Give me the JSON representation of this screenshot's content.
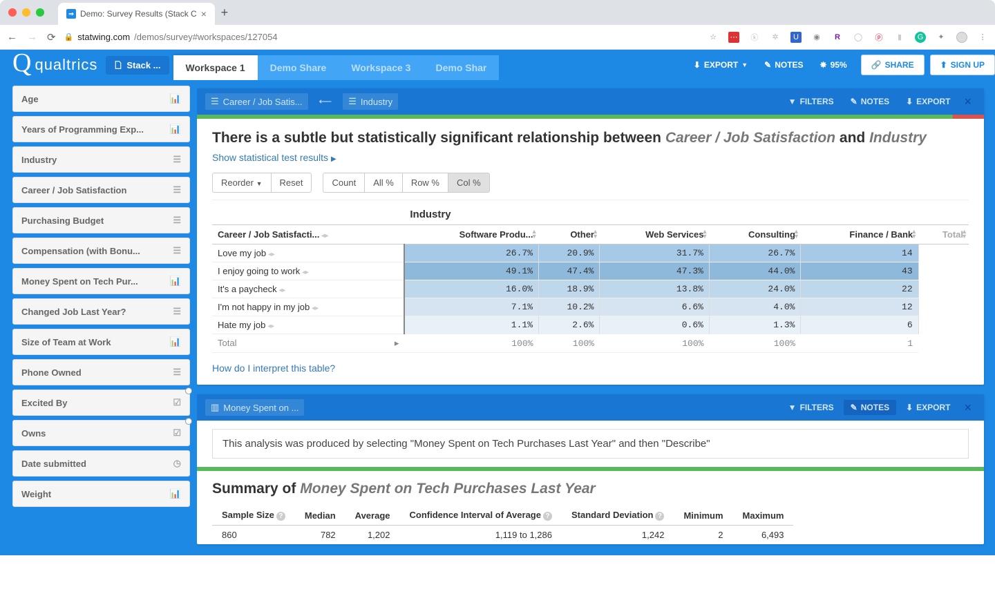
{
  "browser": {
    "tab_title": "Demo: Survey Results (Stack C",
    "url_domain": "statwing.com",
    "url_path": "/demos/survey#workspaces/127054"
  },
  "app": {
    "brand": "qualtrics",
    "file_label": "Stack ...",
    "workspace_tabs": [
      "Workspace 1",
      "Demo Share",
      "Workspace 3",
      "Demo Shar"
    ],
    "header_buttons": {
      "export": "EXPORT",
      "notes": "NOTES",
      "percent": "95%",
      "share": "SHARE",
      "signup": "SIGN UP"
    }
  },
  "sidebar": [
    {
      "label": "Age",
      "icon": "chart"
    },
    {
      "label": "Years of Programming Exp...",
      "icon": "chart"
    },
    {
      "label": "Industry",
      "icon": "list"
    },
    {
      "label": "Career / Job Satisfaction",
      "icon": "list"
    },
    {
      "label": "Purchasing Budget",
      "icon": "list"
    },
    {
      "label": "Compensation (with Bonu...",
      "icon": "list"
    },
    {
      "label": "Money Spent on Tech Pur...",
      "icon": "chart"
    },
    {
      "label": "Changed Job Last Year?",
      "icon": "list"
    },
    {
      "label": "Size of Team at Work",
      "icon": "chart"
    },
    {
      "label": "Phone Owned",
      "icon": "list"
    },
    {
      "label": "Excited By",
      "icon": "check",
      "dot": true
    },
    {
      "label": "Owns",
      "icon": "check",
      "dot": true
    },
    {
      "label": "Date submitted",
      "icon": "clock"
    },
    {
      "label": "Weight",
      "icon": "chart"
    }
  ],
  "card1": {
    "chips": [
      "Career / Job Satis...",
      "Industry"
    ],
    "actions": {
      "filters": "FILTERS",
      "notes": "NOTES",
      "export": "EXPORT"
    },
    "headline_pre": "There is a subtle but statistically significant relationship between ",
    "headline_var1": "Career / Job Satisfaction",
    "headline_mid": " and ",
    "headline_var2": "Industry",
    "show_test": "Show statistical test results",
    "btn_row": {
      "reorder": "Reorder",
      "reset": "Reset",
      "count": "Count",
      "allp": "All %",
      "rowp": "Row %",
      "colp": "Col %"
    },
    "super_col": "Industry",
    "row_header": "Career / Job Satisfacti...",
    "cols": [
      "Software Produ...",
      "Other",
      "Web Services",
      "Consulting",
      "Finance / Bank",
      "Total"
    ],
    "rows": [
      {
        "label": "Love my job",
        "vals": [
          "26.7%",
          "20.9%",
          "31.7%",
          "26.7%",
          "14"
        ]
      },
      {
        "label": "I enjoy going to work",
        "vals": [
          "49.1%",
          "47.4%",
          "47.3%",
          "44.0%",
          "43"
        ]
      },
      {
        "label": "It's a paycheck",
        "vals": [
          "16.0%",
          "18.9%",
          "13.8%",
          "24.0%",
          "22"
        ]
      },
      {
        "label": "I'm not happy in my job",
        "vals": [
          "7.1%",
          "10.2%",
          "6.6%",
          "4.0%",
          "12"
        ]
      },
      {
        "label": "Hate my job",
        "vals": [
          "1.1%",
          "2.6%",
          "0.6%",
          "1.3%",
          "6"
        ]
      }
    ],
    "total_row": {
      "label": "Total",
      "vals": [
        "100%",
        "100%",
        "100%",
        "100%",
        "1"
      ]
    },
    "interpret": "How do I interpret this table?"
  },
  "card2": {
    "chip": "Money Spent on ...",
    "actions": {
      "filters": "FILTERS",
      "notes": "NOTES",
      "export": "EXPORT"
    },
    "note": "This analysis was produced by selecting \"Money Spent on Tech Purchases Last Year\" and then \"Describe\"",
    "title_pre": "Summary of ",
    "title_var": "Money Spent on Tech Purchases Last Year",
    "cols": [
      "Sample Size",
      "Median",
      "Average",
      "Confidence Interval of Average",
      "Standard Deviation",
      "Minimum",
      "Maximum"
    ],
    "vals": [
      "860",
      "782",
      "1,202",
      "1,119 to 1,286",
      "1,242",
      "2",
      "6,493"
    ]
  }
}
